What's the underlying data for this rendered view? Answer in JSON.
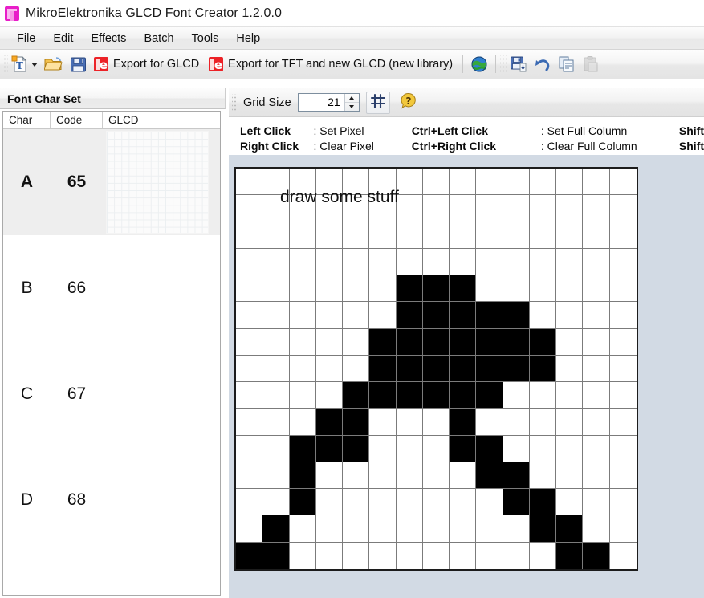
{
  "window": {
    "title": "MikroElektronika GLCD Font Creator 1.2.0.0",
    "icon": "app-font-icon"
  },
  "menubar": {
    "items": [
      {
        "label": "File"
      },
      {
        "label": "Edit"
      },
      {
        "label": "Effects"
      },
      {
        "label": "Batch"
      },
      {
        "label": "Tools"
      },
      {
        "label": "Help"
      }
    ]
  },
  "toolbar": {
    "new_font": {
      "icon": "new-font-icon",
      "label": ""
    },
    "open": {
      "icon": "open-folder-icon",
      "label": ""
    },
    "save": {
      "icon": "save-disk-icon",
      "label": ""
    },
    "export_glcd": {
      "icon": "export-glcd-icon",
      "label": "Export for GLCD"
    },
    "export_tft": {
      "icon": "export-tft-icon",
      "label": "Export for TFT and new GLCD (new library)"
    },
    "web": {
      "icon": "globe-icon",
      "label": ""
    },
    "save_as": {
      "icon": "save-as-icon",
      "label": ""
    },
    "undo": {
      "icon": "undo-icon",
      "label": ""
    },
    "copy": {
      "icon": "copy-icon",
      "label": ""
    },
    "paste": {
      "icon": "paste-icon",
      "label": "",
      "disabled": true
    }
  },
  "gridbar": {
    "grid_size_label": "Grid Size",
    "grid_size_value": "21",
    "toggle_grid": {
      "icon": "grid-toggle-icon"
    },
    "help": {
      "icon": "help-question-icon"
    }
  },
  "left_panel": {
    "header": "Font Char Set",
    "columns": [
      "Char",
      "Code",
      "GLCD"
    ],
    "rows": [
      {
        "char": "A",
        "code": "65",
        "selected": true,
        "has_preview": true
      },
      {
        "char": "B",
        "code": "66",
        "selected": false,
        "has_preview": false
      },
      {
        "char": "C",
        "code": "67",
        "selected": false,
        "has_preview": false
      },
      {
        "char": "D",
        "code": "68",
        "selected": false,
        "has_preview": false
      }
    ]
  },
  "editor": {
    "hints": [
      {
        "key1": "Left Click",
        "val1": ": Set Pixel",
        "key2": "Ctrl+Left Click",
        "val2": ": Set Full Column",
        "key3": "Shift"
      },
      {
        "key1": "Right Click",
        "val1": ": Clear Pixel",
        "key2": "Ctrl+Right Click",
        "val2": ": Clear Full Column",
        "key3": "Shift"
      }
    ],
    "canvas_note": "draw some stuff",
    "grid": {
      "cols": 15,
      "rows": 15,
      "on_color": "#000000",
      "off_color": "#ffffff",
      "line_color": "#7b7b7b",
      "filled": [
        [],
        [],
        [],
        [],
        [
          6,
          7,
          8
        ],
        [
          6,
          7,
          8,
          9,
          10
        ],
        [
          5,
          6,
          7,
          8,
          9,
          10,
          11
        ],
        [
          5,
          6,
          7,
          8,
          9,
          10,
          11
        ],
        [
          4,
          5,
          6,
          7,
          8,
          9
        ],
        [
          3,
          4,
          8
        ],
        [
          2,
          3,
          4,
          8,
          9
        ],
        [
          2,
          9,
          10
        ],
        [
          2,
          10,
          11
        ],
        [
          1,
          11,
          12
        ],
        [
          0,
          1,
          12,
          13
        ]
      ]
    }
  },
  "colors": {
    "canvas_background": "#d2dae4",
    "accent": "#e81ec8",
    "selection": "#eeeeee"
  }
}
